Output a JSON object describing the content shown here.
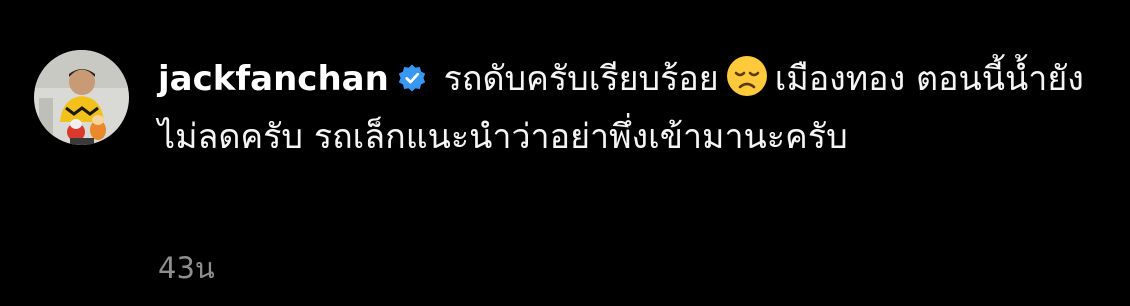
{
  "comment": {
    "username": "jackfanchan",
    "verified": true,
    "text_before_emoji": "รถดับครับเรียบร้อย",
    "emoji": "disappointed-face",
    "text_after_emoji": "เมืองทอง ตอนนี้น้ำยังไม่ลดครับ รถเล็กแนะนำว่าอย่าพึ่งเข้ามานะครับ",
    "time_ago": "43น"
  },
  "colors": {
    "background": "#000000",
    "text": "#f5f5f5",
    "meta_text": "#8e8e8e",
    "verified_badge": "#3897f0",
    "emoji_face": "#ffc93c"
  }
}
